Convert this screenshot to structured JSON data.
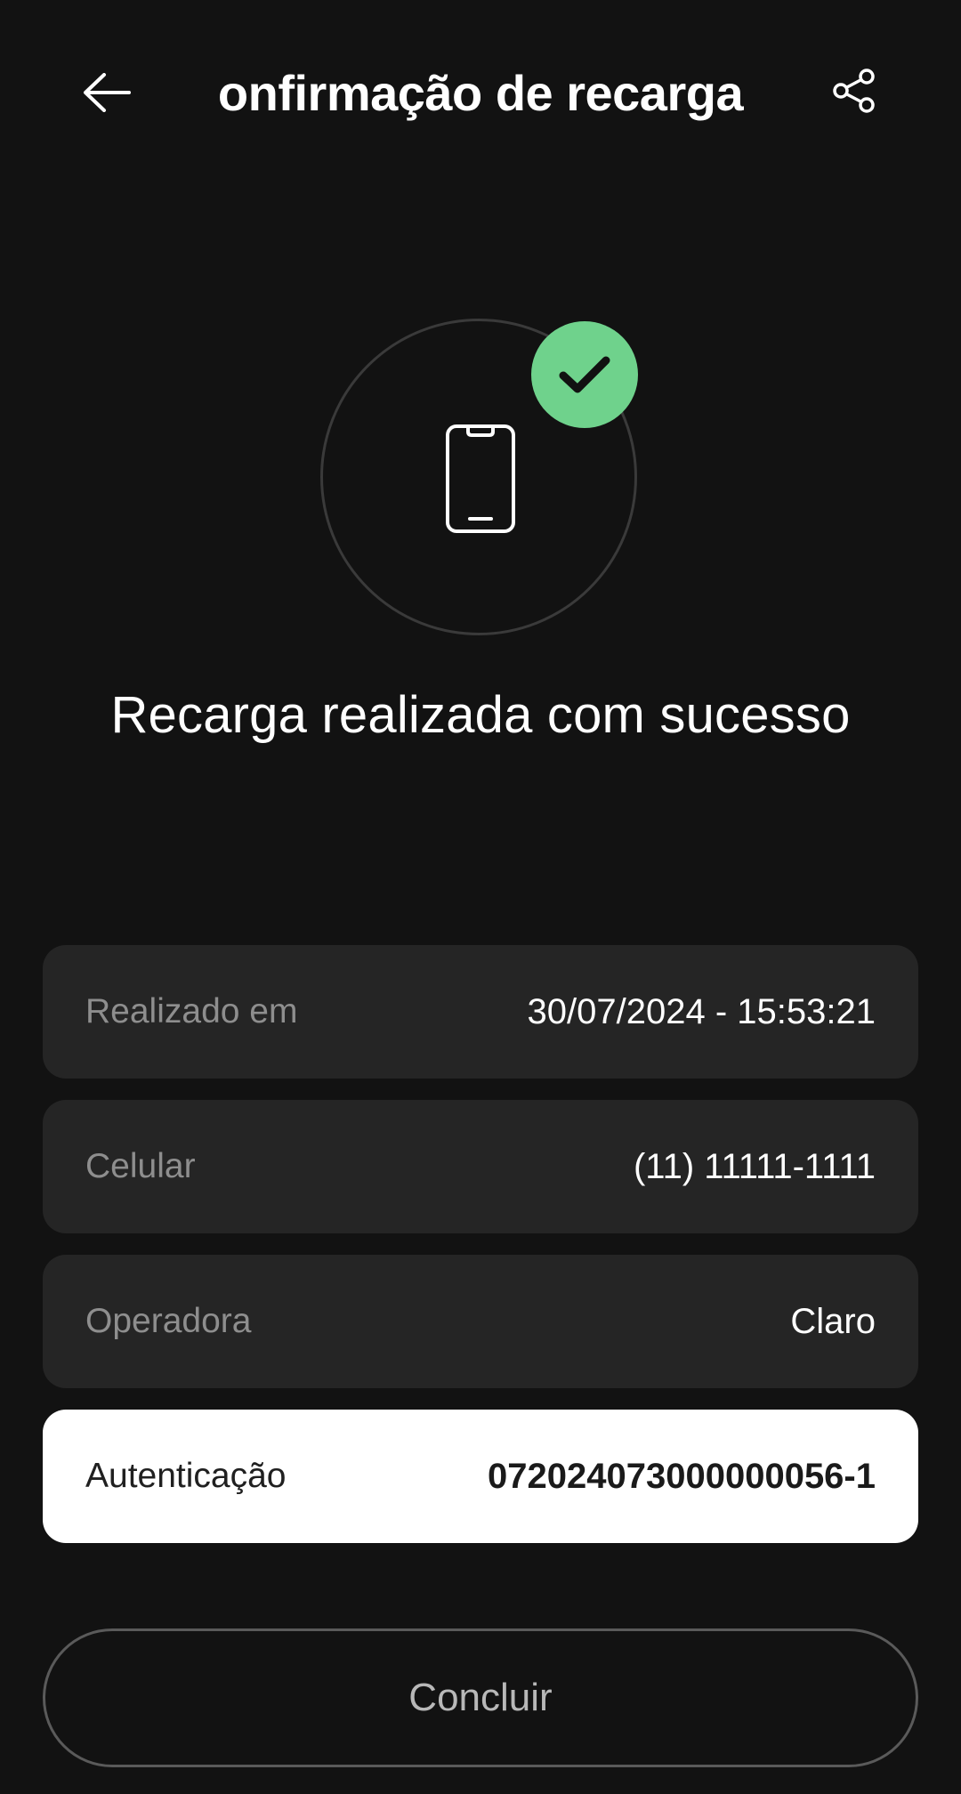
{
  "header": {
    "title": "onfirmação de recarga",
    "back_icon": "arrow-left-icon",
    "share_icon": "share-icon"
  },
  "status": {
    "device_icon": "smartphone-icon",
    "badge_icon": "check-icon",
    "badge_color": "#6fd28c",
    "message": "Recarga realizada com sucesso"
  },
  "details": [
    {
      "label": "Realizado em",
      "value": "30/07/2024 - 15:53:21"
    },
    {
      "label": "Celular",
      "value": "(11) 11111-1111"
    },
    {
      "label": "Operadora",
      "value": "Claro"
    },
    {
      "label": "Autenticação",
      "value": "072024073000000056-1"
    }
  ],
  "actions": {
    "done_label": "Concluir"
  }
}
